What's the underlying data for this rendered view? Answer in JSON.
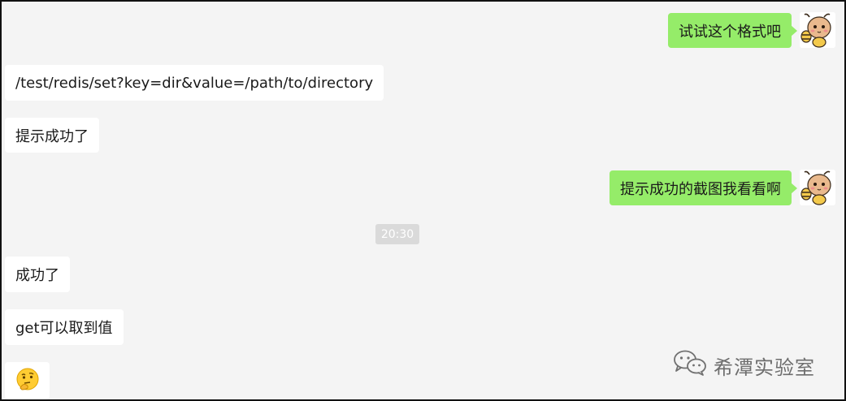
{
  "messages": [
    {
      "side": "out",
      "text": "试试这个格式吧",
      "avatar_icon": "bee-avatar-icon"
    },
    {
      "side": "in",
      "text": "/test/redis/set?key=dir&value=/path/to/directory"
    },
    {
      "side": "in",
      "text": "提示成功了"
    },
    {
      "side": "out",
      "text": "提示成功的截图我看看啊",
      "avatar_icon": "bee-avatar-icon"
    },
    {
      "side": "in",
      "text": "成功了"
    },
    {
      "side": "in",
      "text": "get可以取到值"
    },
    {
      "side": "in",
      "emoji": "thinking-face-emoji"
    }
  ],
  "timestamp": "20:30",
  "watermark": {
    "icon": "wechat-icon",
    "text": "希潭实验室"
  },
  "colors": {
    "background": "#f4f4f4",
    "outgoing_bubble": "#95ec69",
    "incoming_bubble": "#ffffff",
    "timestamp_bg": "#dadada"
  }
}
